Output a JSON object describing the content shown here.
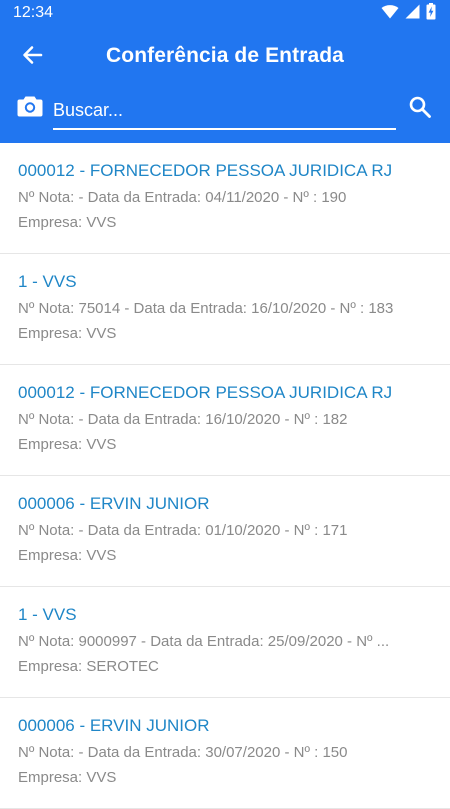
{
  "status_bar": {
    "time": "12:34",
    "icons": [
      "wifi-icon",
      "signal-icon",
      "battery-charging-icon"
    ]
  },
  "toolbar": {
    "back_icon": "arrow-left-icon",
    "title": "Conferência de Entrada"
  },
  "search": {
    "camera_icon": "camera-icon",
    "placeholder": "Buscar...",
    "value": "",
    "search_icon": "search-icon"
  },
  "colors": {
    "primary": "#2176f0",
    "item_title": "#1f86c7",
    "item_text": "#8a8a8a"
  },
  "entries": [
    {
      "title": "000012 - FORNECEDOR PESSOA JURIDICA RJ",
      "details": "Nº Nota:  - Data da Entrada: 04/11/2020 - Nº : 190",
      "empresa": "Empresa: VVS"
    },
    {
      "title": "1 - VVS",
      "details": "Nº Nota: 75014 - Data da Entrada: 16/10/2020 - Nº : 183",
      "empresa": "Empresa: VVS"
    },
    {
      "title": "000012 - FORNECEDOR PESSOA JURIDICA RJ",
      "details": "Nº Nota:  - Data da Entrada: 16/10/2020 - Nº : 182",
      "empresa": "Empresa: VVS"
    },
    {
      "title": "000006 - ERVIN JUNIOR",
      "details": "Nº Nota:  - Data da Entrada: 01/10/2020 - Nº : 171",
      "empresa": "Empresa: VVS"
    },
    {
      "title": "1 - VVS",
      "details": "Nº Nota: 9000997 - Data da Entrada: 25/09/2020 - Nº ...",
      "empresa": "Empresa: SEROTEC"
    },
    {
      "title": "000006 - ERVIN JUNIOR",
      "details": "Nº Nota:  - Data da Entrada: 30/07/2020 - Nº : 150",
      "empresa": "Empresa: VVS"
    }
  ]
}
